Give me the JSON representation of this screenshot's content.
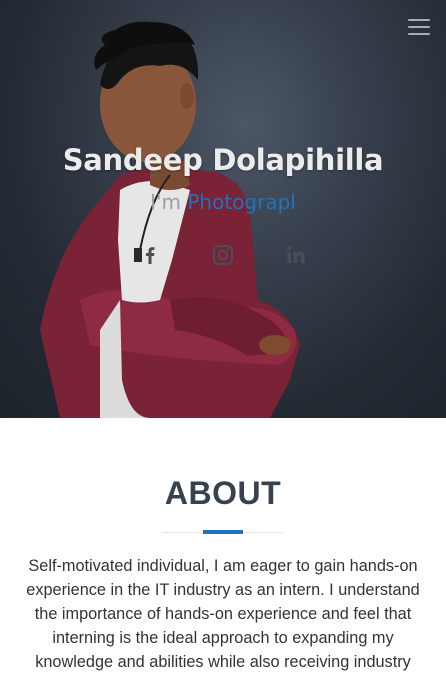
{
  "hero": {
    "name": "Sandeep Dolapihilla",
    "intro_prefix": "I'm ",
    "typed_text": "Photograpl",
    "colors": {
      "accent": "#1e73be",
      "background": "#2a313b",
      "jacket": "#7d2337"
    }
  },
  "menu": {
    "icon": "hamburger-icon"
  },
  "social": [
    {
      "icon": "facebook-icon"
    },
    {
      "icon": "instagram-icon"
    },
    {
      "icon": "linkedin-icon"
    }
  ],
  "about": {
    "title": "ABOUT",
    "text": "Self-motivated individual, I am eager to gain hands-on experience in the IT industry as an intern. I understand the importance of hands-on experience and feel that interning is the ideal approach to expanding my knowledge and abilities while also receiving industry"
  }
}
